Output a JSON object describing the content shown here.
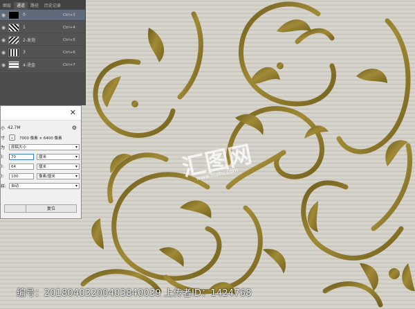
{
  "panel": {
    "tabs": [
      "图层",
      "通道",
      "路径",
      "历史记录"
    ],
    "active_tab_index": 1,
    "channels": [
      {
        "name": "0",
        "shortcut": "Ctrl+3",
        "selected": true
      },
      {
        "name": "1",
        "shortcut": "Ctrl+4",
        "selected": false
      },
      {
        "name": "2-发泡",
        "shortcut": "Ctrl+5",
        "selected": false
      },
      {
        "name": "3",
        "shortcut": "Ctrl+6",
        "selected": false
      },
      {
        "name": "4-烫金",
        "shortcut": "Ctrl+7",
        "selected": false
      }
    ]
  },
  "dialog": {
    "close_glyph": "✕",
    "size_value": "42.7M",
    "dimensions_value": "7000 像素 × 6400 像素",
    "fit_value": "原稿大小",
    "width_value": "70",
    "width_unit": "厘米",
    "height_value": "64",
    "height_unit": "厘米",
    "resolution_value": "100",
    "resolution_unit": "像素/厘米",
    "resample_value": "自动",
    "reset_label": "复位",
    "row_labels": [
      "小",
      "寸",
      "为",
      "):",
      "):",
      "):",
      "样:"
    ]
  },
  "watermark": {
    "brand": "汇图网",
    "domain": "www.huitu.com"
  },
  "footer": {
    "info": "编号：20180403200403840039 上传者ID：1424768"
  },
  "colors": {
    "gold": "#8a7528",
    "canvas_bg": "#cfccc4",
    "panel_bg": "#535353"
  }
}
